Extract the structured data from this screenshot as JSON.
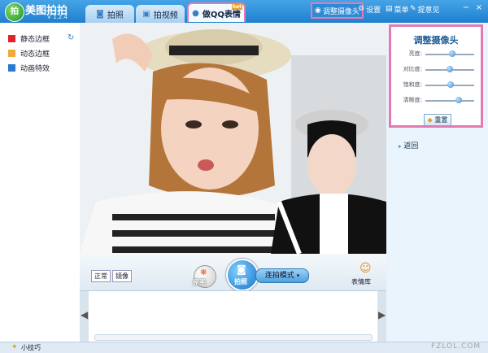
{
  "app": {
    "name": "美图拍拍",
    "version": "V 1.2.4",
    "logo_char": "拍"
  },
  "tabs": [
    {
      "label": "拍照",
      "icon": "camera-icon"
    },
    {
      "label": "拍视频",
      "icon": "video-icon"
    },
    {
      "label": "做QQ表情",
      "icon": "qq-penguin-icon",
      "badge": "hot"
    }
  ],
  "titlebar_right": {
    "adjust_camera": "调整摄像头",
    "settings": "设置",
    "menu": "菜单",
    "feedback": "提意见"
  },
  "sidebar": {
    "items": [
      {
        "label": "静态边框",
        "color": "#e0242a"
      },
      {
        "label": "动态边框",
        "color": "#f2a93b"
      },
      {
        "label": "动画特效",
        "color": "#2a7bd0"
      }
    ]
  },
  "adjust_panel": {
    "title": "调整摄像头",
    "sliders": [
      {
        "label": "亮度:",
        "value": 0.55
      },
      {
        "label": "对比度:",
        "value": 0.5
      },
      {
        "label": "饱和度:",
        "value": 0.52
      },
      {
        "label": "清晰度:",
        "value": 0.68
      }
    ],
    "reset": "重置",
    "back": "返回"
  },
  "controls": {
    "normal": "正常",
    "mirror": "镜像",
    "original": "原图",
    "shoot": "拍照",
    "mode": "连拍模式",
    "library": "表情库"
  },
  "status": {
    "tips": "小技巧",
    "watermark": "FZLOL.COM"
  },
  "colors": {
    "highlight": "#e57ab0",
    "title_blue": "#2d8ad6"
  }
}
